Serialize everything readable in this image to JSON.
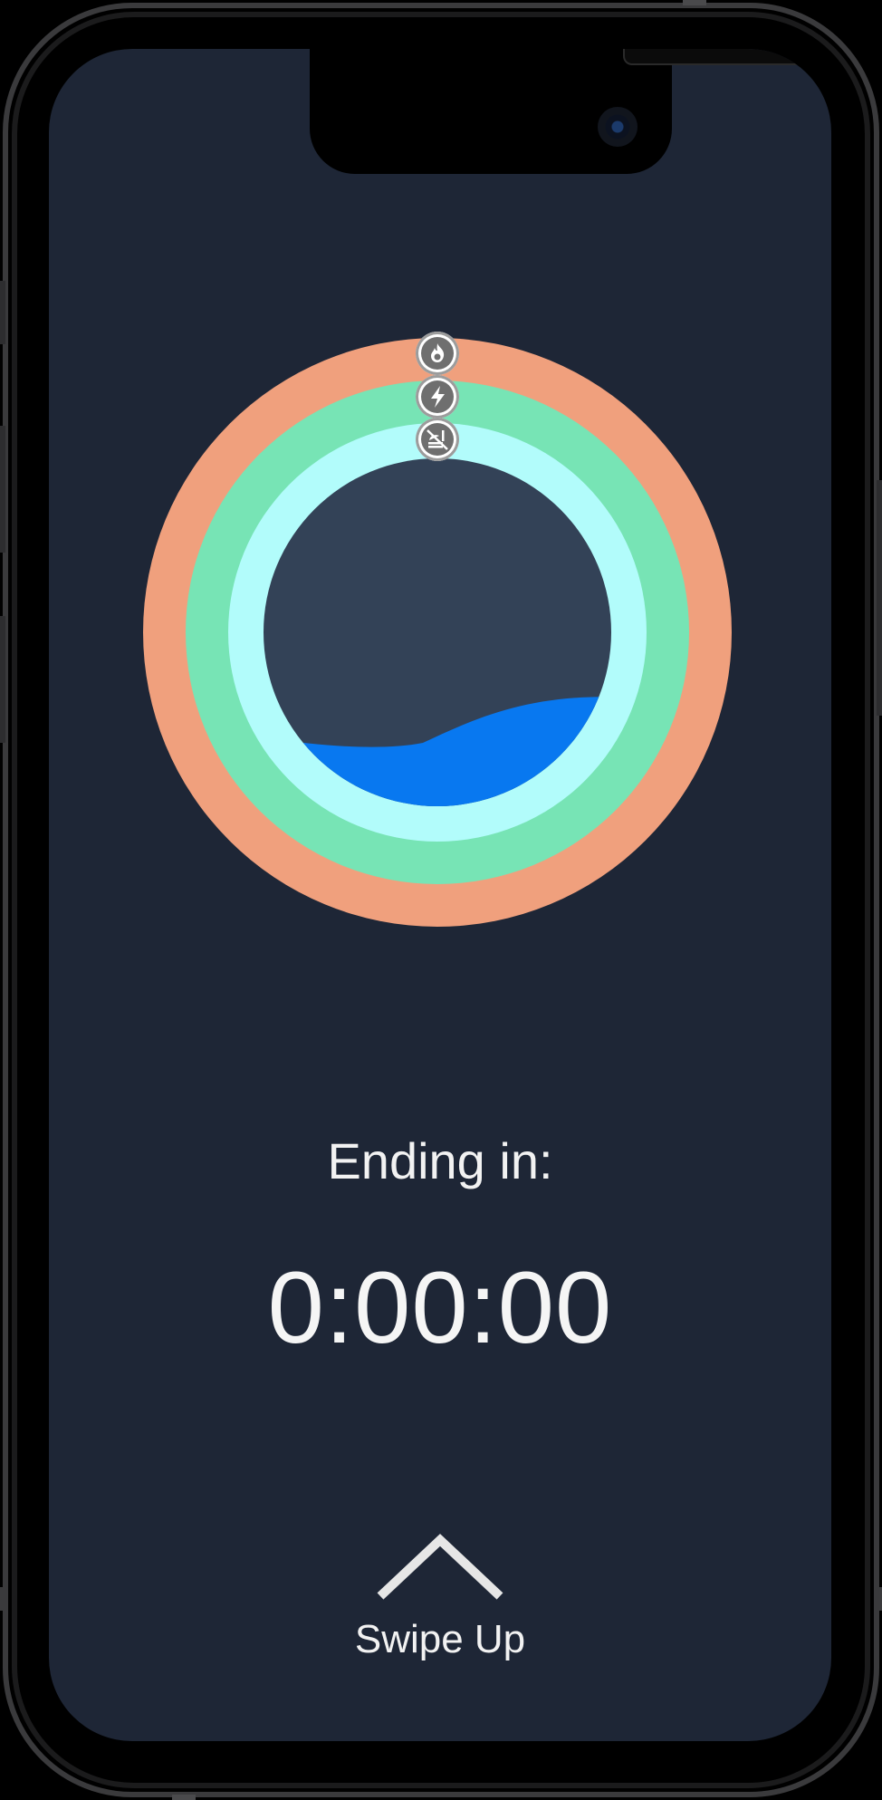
{
  "colors": {
    "background": "#1e2636",
    "outer_ring": "#f0a07d",
    "middle_ring": "#77e4b5",
    "inner_ring": "#b2fcfb",
    "center": "#334257",
    "water": "#0878f0",
    "text": "#f2f2f2"
  },
  "rings": {
    "outer_icon": "flame-icon",
    "middle_icon": "lightning-icon",
    "inner_icon": "no-food-icon"
  },
  "countdown": {
    "label": "Ending in:",
    "time": "0:00:00"
  },
  "swipe": {
    "icon": "chevron-up-icon",
    "label": "Swipe Up"
  }
}
